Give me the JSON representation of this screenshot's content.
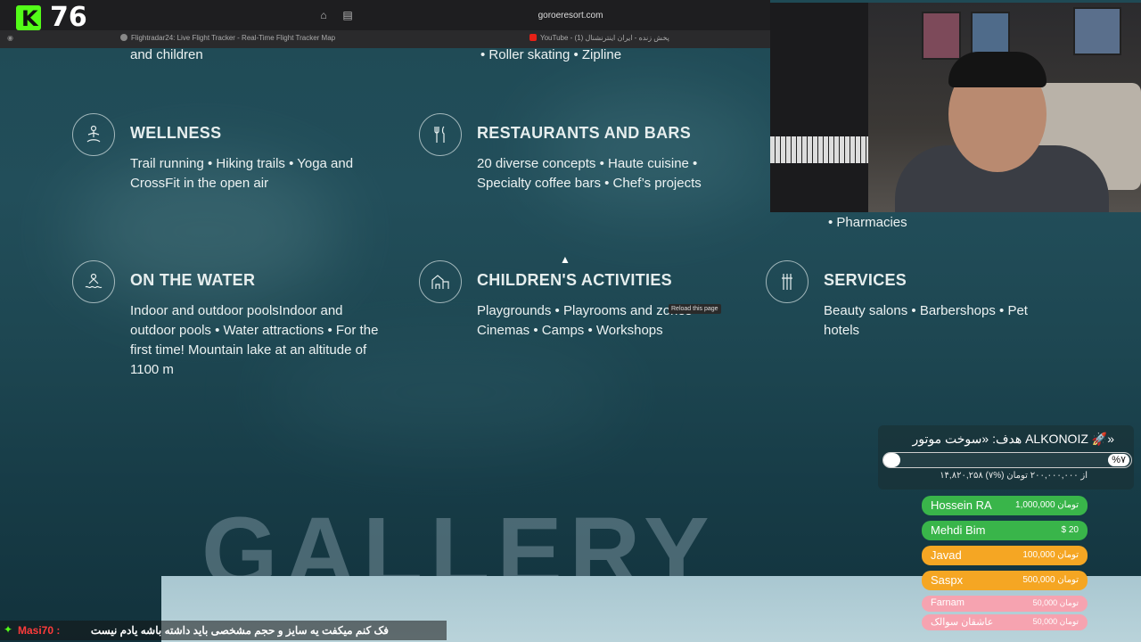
{
  "stream": {
    "logo_letter": "K",
    "viewer_count": "76"
  },
  "browser": {
    "url": "goroeresort.com",
    "tabs": [
      {
        "label": "Flightradar24: Live Flight Tracker - Real-Time Flight Tracker Map"
      },
      {
        "label": "YouTube - پخش زنده - ایران اینترنشنال (1)"
      }
    ]
  },
  "page": {
    "top_fragments": {
      "left": "and children",
      "middle": "• Roller skating  • Zipline",
      "right": "• Pharmacies"
    },
    "features": [
      {
        "title": "WELLNESS",
        "icon": "yoga-icon",
        "text": "Trail running  • Hiking trails  • Yoga and CrossFit in the open air"
      },
      {
        "title": "RESTAURANTS AND BARS",
        "icon": "cutlery-icon",
        "text": "20 diverse concepts  • Haute cuisine  • Specialty coffee bars  • Chef’s projects"
      },
      {
        "title": "ON THE WATER",
        "icon": "pool-icon",
        "text": "Indoor and outdoor poolsIndoor and outdoor pools  • Water attractions  • For the first time! Mountain lake at an altitude of 1100 m"
      },
      {
        "title": "CHILDREN'S ACTIVITIES",
        "icon": "playhouse-icon",
        "text": "Playgrounds  • Playrooms and zones  • Cinemas  • Camps  • Workshops"
      },
      {
        "title": "SERVICES",
        "icon": "services-icon",
        "text": "Beauty salons  • Barbershops  • Pet hotels"
      }
    ],
    "gallery_heading": "GALLERY",
    "tooltip": "Reload this page"
  },
  "donation_goal": {
    "title": "هدف: «سوخت موتور ALKONOIZ 🚀»",
    "percent_label": "%۷",
    "progress": 0.07,
    "amount": "۱۴,۸۲۰,۲۵۸ از ۲۰۰,۰۰۰,۰۰۰ تومان (%۷)"
  },
  "donations": [
    {
      "name": "Hossein RA",
      "amount": "1,000,000 تومان",
      "color": "#39b54a"
    },
    {
      "name": "Mehdi Bim",
      "amount": "$ 20",
      "color": "#39b54a"
    },
    {
      "name": "Javad",
      "amount": "100,000 تومان",
      "color": "#f5a623"
    },
    {
      "name": "Saspx",
      "amount": "500,000 تومان",
      "color": "#f5a623"
    },
    {
      "name": "Farnam",
      "amount": "50,000 تومان",
      "color": "#f6a3b0"
    },
    {
      "name": "عاشقان سوالک",
      "amount": "50,000 تومان",
      "color": "#f6a3b0"
    }
  ],
  "chat": {
    "user": "Masi70 :",
    "message": "فک کنم میکفت یه سایز و حجم مشخصی باید داشته باشه یادم نیست"
  },
  "colors": {
    "kick_green": "#53fc18",
    "page_bg": "#1f4a55"
  }
}
